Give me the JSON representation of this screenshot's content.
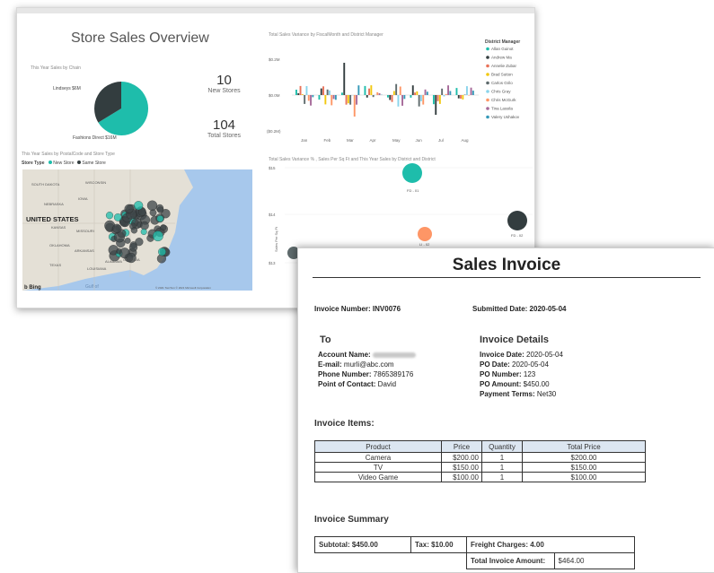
{
  "dashboard": {
    "title": "Store Sales Overview",
    "pie": {
      "caption": "This Year Sales by Chain",
      "labels": [
        "Lindseys $6M",
        "Fashions Direct $16M"
      ],
      "colors": [
        "#333d3f",
        "#1ebdab"
      ]
    },
    "kpis": [
      {
        "value": "10",
        "label": "New Stores"
      },
      {
        "value": "104",
        "label": "Total Stores"
      }
    ],
    "map": {
      "caption": "This Year Sales by PostalCode and Store Type",
      "legend_title": "Store Type",
      "legend_items": [
        "New Store",
        "Same Store"
      ],
      "labels": [
        "SOUTH DAKOTA",
        "WISCONSIN",
        "IOWA",
        "NEBRASKA",
        "UNITED STATES",
        "KANSAS",
        "MISSOURI",
        "OKLAHOMA",
        "ARKANSAS",
        "TEXAS",
        "ALABAMA",
        "GEORGIA",
        "LOUISIANA",
        "Gulf of"
      ],
      "attribution": "© 2021 TomTom © 2021 Microsoft Corporation",
      "bing": "b Bing"
    },
    "bar_chart": {
      "caption": "Total Sales Variance by FiscalMonth and District Manager",
      "yticks": [
        "$0.2M",
        "$0.0M",
        "($0.2M)"
      ],
      "months": [
        "Jan",
        "Feb",
        "Mar",
        "Apr",
        "May",
        "Jun",
        "Jul",
        "Aug"
      ],
      "legend_title": "District Manager",
      "managers": [
        {
          "name": "Allan Guinot",
          "color": "#1ebdab"
        },
        {
          "name": "Andrew Ma",
          "color": "#333d3f"
        },
        {
          "name": "Annelie Zubar",
          "color": "#e8735a"
        },
        {
          "name": "Brad Sutton",
          "color": "#f2c80f"
        },
        {
          "name": "Carlos Grilo",
          "color": "#5f6b6d"
        },
        {
          "name": "Chris Gray",
          "color": "#8ad4eb"
        },
        {
          "name": "Chris McGurk",
          "color": "#fe9666"
        },
        {
          "name": "Tina Lassila",
          "color": "#a66999"
        },
        {
          "name": "Valery Ushakov",
          "color": "#3599b8"
        }
      ]
    },
    "scatter": {
      "caption": "Total Sales Variance % , Sales Per Sq Ft and This Year Sales by District and District",
      "yticks": [
        "$15",
        "$14",
        "$13"
      ],
      "ylabel": "Sales Per Sq Ft",
      "point_labels": [
        "FD - 01",
        "LI - 02",
        "FD - 02",
        "LI - 01"
      ]
    }
  },
  "invoice": {
    "title": "Sales Invoice",
    "invoice_number": "Invoice Number: INV0076",
    "submitted_date": "Submitted Date: 2020-05-04",
    "to_heading": "To",
    "account_name_label": "Account Name:",
    "email_label": "E-mail:",
    "email_value": "murli@abc.com",
    "phone_label": "Phone Number:",
    "phone_value": "7865389176",
    "contact_label": "Point of Contact:",
    "contact_value": "David",
    "details_heading": "Invoice Details",
    "invoice_date_label": "Invoice Date:",
    "invoice_date_value": "2020-05-04",
    "po_date_label": "PO Date:",
    "po_date_value": "2020-05-04",
    "po_number_label": "PO Number:",
    "po_number_value": "123",
    "po_amount_label": "PO Amount:",
    "po_amount_value": "$450.00",
    "payment_terms_label": "Payment Terms:",
    "payment_terms_value": "Net30",
    "items_heading": "Invoice Items:",
    "items_columns": [
      "Product",
      "Price",
      "Quantity",
      "Total Price"
    ],
    "items_rows": [
      [
        "Camera",
        "$200.00",
        "1",
        "$200.00"
      ],
      [
        "TV",
        "$150.00",
        "1",
        "$150.00"
      ],
      [
        "Video Game",
        "$100.00",
        "1",
        "$100.00"
      ]
    ],
    "summary_heading": "Invoice Summary",
    "subtotal": "Subtotal: $450.00",
    "tax": "Tax: $10.00",
    "freight": "Freight Charges: 4.00",
    "total_label": "Total Invoice Amount:",
    "total_value": "$464.00"
  }
}
